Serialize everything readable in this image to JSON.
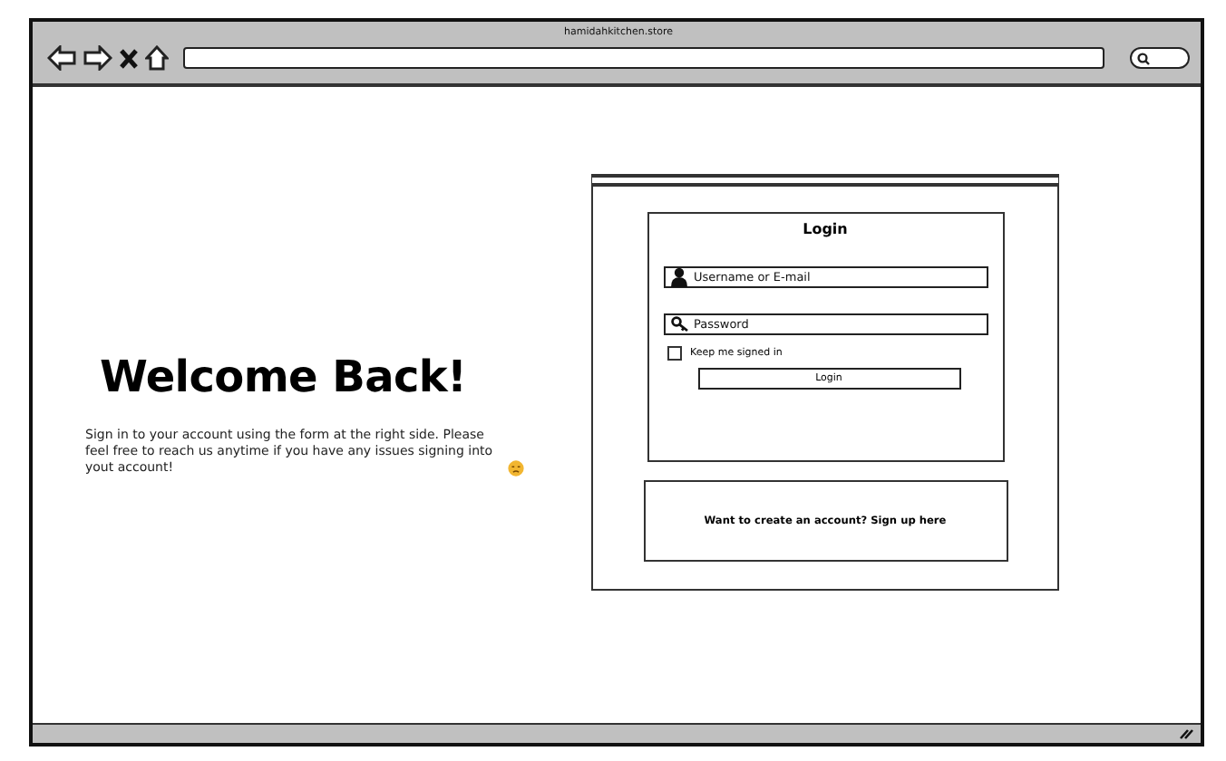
{
  "browser": {
    "address": "hamidahkitchen.store"
  },
  "welcome": {
    "heading": "Welcome Back!",
    "message": "Sign in to your account using the form at the right side. Please feel free to reach us anytime if you have any issues signing into yout account!"
  },
  "login": {
    "title": "Login",
    "username": {
      "placeholder": "Username or E-mail"
    },
    "password": {
      "placeholder": "Password"
    },
    "remember": {
      "label": "Keep me signed in",
      "checked": false
    },
    "button": "Login"
  },
  "signup": {
    "text": "Want to create an account? Sign up here"
  }
}
